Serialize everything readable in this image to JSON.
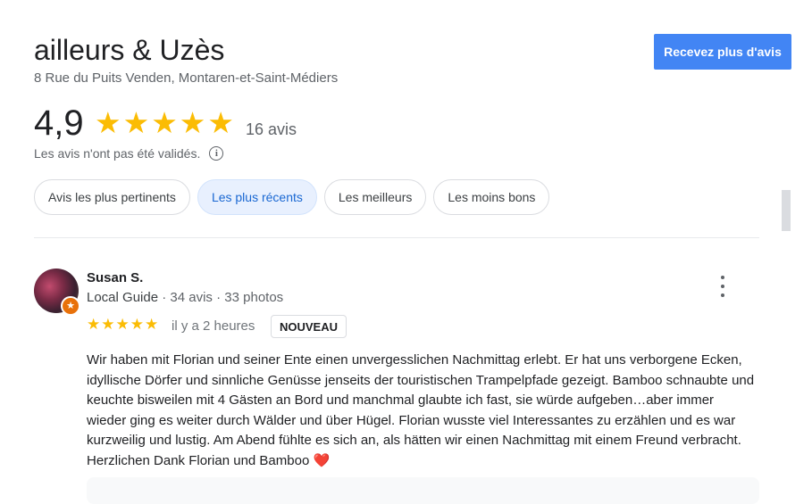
{
  "place": {
    "name": "ailleurs & Uzès",
    "address": "8 Rue du Puits Venden, Montaren-et-Saint-Médiers"
  },
  "cta": {
    "label": "Recevez plus d'avis",
    "color": "#4285f4"
  },
  "rating": {
    "score": "4,9",
    "stars_filled": 5,
    "count_label": "16 avis",
    "disclaimer": "Les avis n'ont pas été validés.",
    "star_color": "#fbbc04"
  },
  "filters": [
    {
      "label": "Avis les plus pertinents",
      "active": false
    },
    {
      "label": "Les plus récents",
      "active": true
    },
    {
      "label": "Les meilleurs",
      "active": false
    },
    {
      "label": "Les moins bons",
      "active": false
    }
  ],
  "review": {
    "author": "Susan S.",
    "guide_label": "Local Guide",
    "reviews_count": "34 avis",
    "photos_count": "33 photos",
    "separator": "·",
    "stars": 5,
    "time": "il y a 2 heures",
    "badge": "NOUVEAU",
    "text": "Wir haben mit Florian und seiner Ente einen unvergesslichen Nachmittag erlebt. Er hat uns verborgene Ecken, idyllische Dörfer und sinnliche Genüsse  jenseits der touristischen Trampelpfade gezeigt. Bamboo schnaubte und keuchte bisweilen mit 4 Gästen an Bord und manchmal glaubte ich fast, sie würde aufgeben…aber immer wieder ging es weiter durch Wälder und über Hügel. Florian wusste viel Interessantes zu erzählen und es war kurzweilig und lustig. Am Abend fühlte es sich an, als hätten wir einen Nachmittag mit einem Freund verbracht. Herzlichen Dank Florian und Bamboo",
    "emoji": "❤️"
  },
  "icons": {
    "info": "info-icon",
    "more": "more-vert-icon",
    "guide": "local-guide-badge-icon",
    "star": "star-icon"
  }
}
